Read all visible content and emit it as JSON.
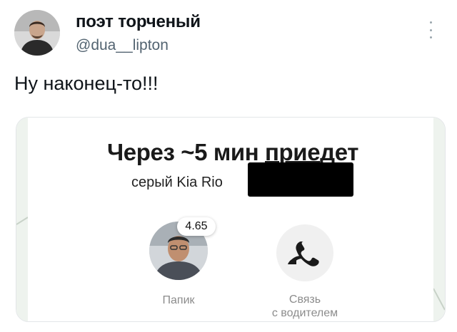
{
  "tweet": {
    "author_name": "поэт торченый",
    "author_handle": "@dua__lipton",
    "text": "Ну наконец-то!!!"
  },
  "card": {
    "headline_prefix": "Через ~5 мин ",
    "headline_underlined": "прие",
    "headline_suffix": "дет",
    "car_description": "серый Kia Rio",
    "driver_rating": "4.65",
    "driver_name": "Папик",
    "call_label_line1": "Связь",
    "call_label_line2": "с водителем"
  },
  "icons": {
    "more": "more-vertical-icon",
    "call": "phone-icon"
  }
}
